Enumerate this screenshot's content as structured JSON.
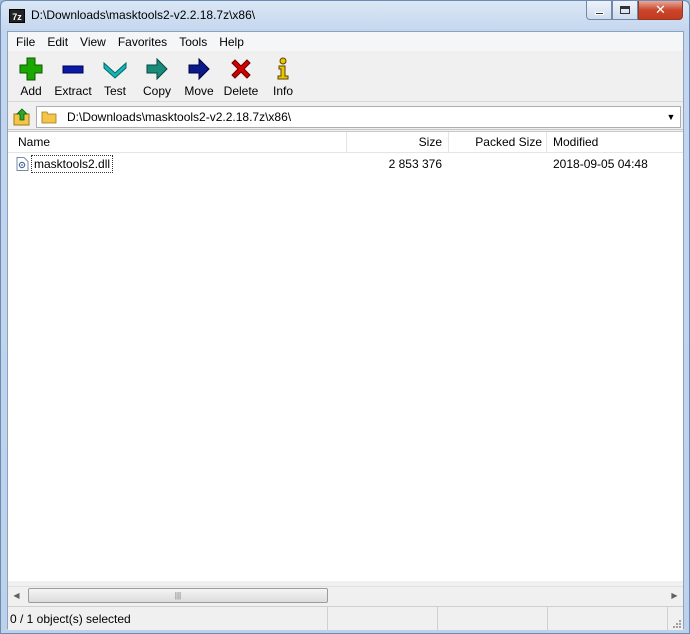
{
  "window": {
    "title": "D:\\Downloads\\masktools2-v2.2.18.7z\\x86\\",
    "app_icon_text": "7z"
  },
  "menu": [
    {
      "label": "File"
    },
    {
      "label": "Edit"
    },
    {
      "label": "View"
    },
    {
      "label": "Favorites"
    },
    {
      "label": "Tools"
    },
    {
      "label": "Help"
    }
  ],
  "toolbar": {
    "add": "Add",
    "extract": "Extract",
    "test": "Test",
    "copy": "Copy",
    "move": "Move",
    "delete": "Delete",
    "info": "Info"
  },
  "address": {
    "path": "D:\\Downloads\\masktools2-v2.2.18.7z\\x86\\"
  },
  "columns": {
    "name": "Name",
    "size": "Size",
    "packed": "Packed Size",
    "modified": "Modified"
  },
  "files": [
    {
      "name": "masktools2.dll",
      "size": "2 853 376",
      "packed": "",
      "modified": "2018-09-05 04:48"
    }
  ],
  "status": {
    "selection": "0 / 1 object(s) selected"
  },
  "scrollbar": {
    "thumb_glyph": "|||"
  },
  "colors": {
    "add": "#1aa800",
    "extract": "#0a1aa8",
    "test": "#17b5b5",
    "copy": "#1a8a7a",
    "move": "#0a1a8a",
    "delete": "#d40000",
    "info": "#e6c800"
  }
}
